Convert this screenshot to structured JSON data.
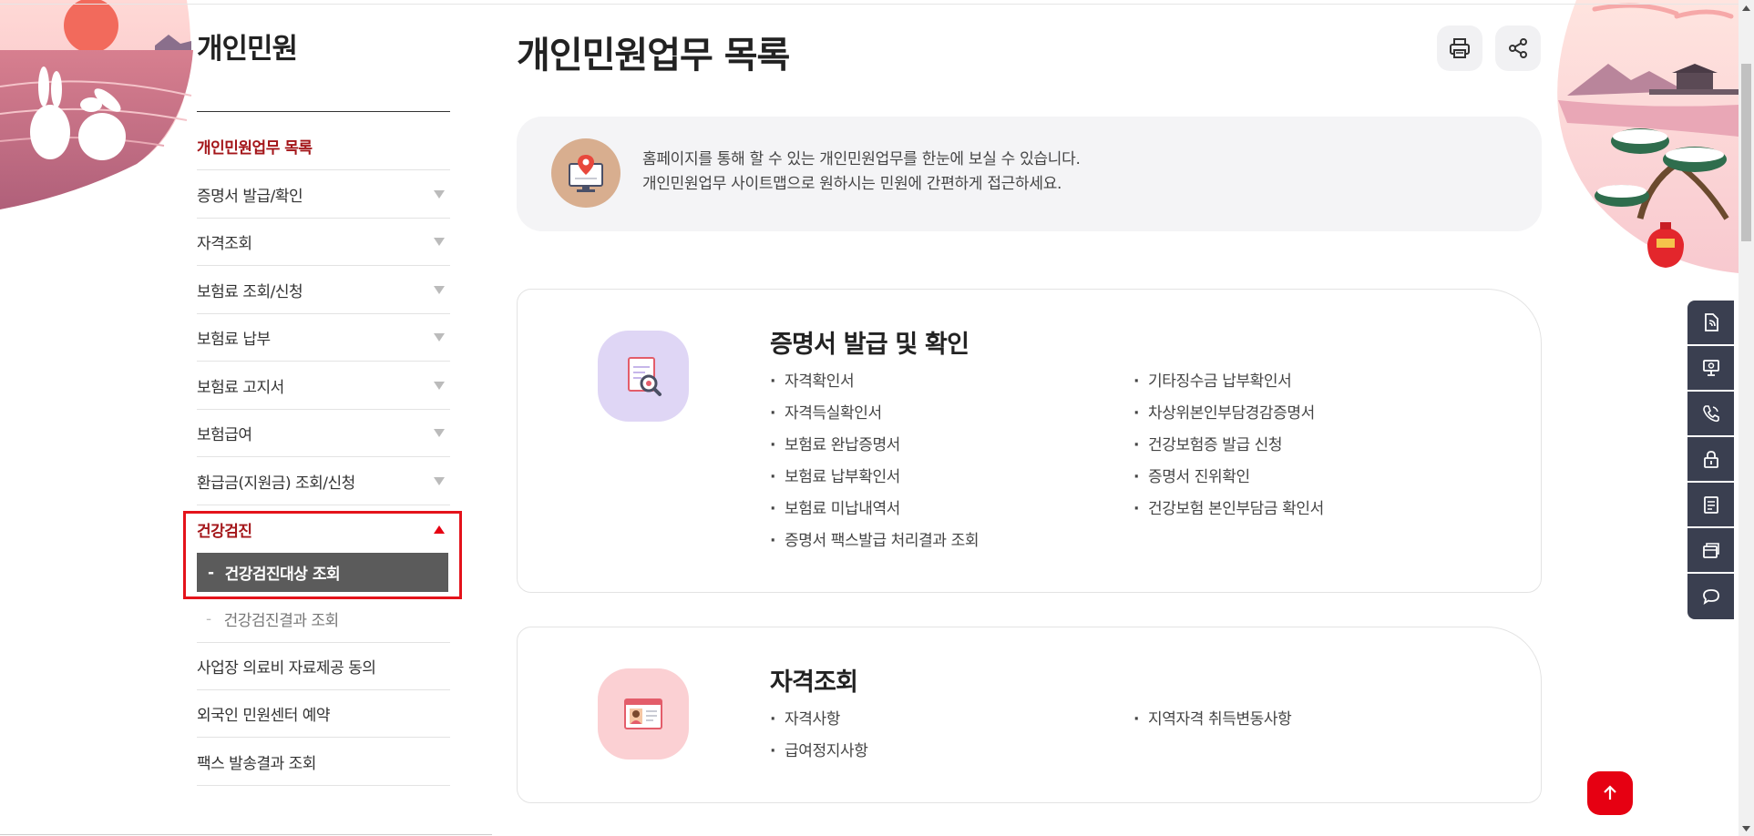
{
  "sidebar": {
    "title": "개인민원",
    "items": [
      {
        "label": "개인민원업무 목록"
      },
      {
        "label": "증명서 발급/확인"
      },
      {
        "label": "자격조회"
      },
      {
        "label": "보험료 조회/신청"
      },
      {
        "label": "보험료 납부"
      },
      {
        "label": "보험료 고지서"
      },
      {
        "label": "보험급여"
      },
      {
        "label": "환급금(지원금) 조회/신청"
      },
      {
        "label": "건강검진"
      },
      {
        "label": "사업장 의료비 자료제공 동의"
      },
      {
        "label": "외국인 민원센터 예약"
      },
      {
        "label": "팩스 발송결과 조회"
      }
    ],
    "sub_items": [
      {
        "label": "건강검진대상 조회"
      },
      {
        "label": "건강검진결과 조회"
      }
    ],
    "sub_dash": "-"
  },
  "main": {
    "title": "개인민원업무 목록",
    "intro_line1": "홈페이지를 통해 할 수 있는 개인민원업무를 한눈에 보실 수 있습니다.",
    "intro_line2": "개인민원업무 사이트맵으로 원하시는 민원에 간편하게 접근하세요.",
    "cards": [
      {
        "title": "증명서 발급 및 확인",
        "col1": [
          "자격확인서",
          "자격득실확인서",
          "보험료 완납증명서",
          "보험료 납부확인서",
          "보험료 미납내역서",
          "증명서 팩스발급 처리결과 조회"
        ],
        "col2": [
          "기타징수금 납부확인서",
          "차상위본인부담경감증명서",
          "건강보험증 발급 신청",
          "증명서 진위확인",
          "건강보험 본인부담금 확인서"
        ]
      },
      {
        "title": "자격조회",
        "col1": [
          "자격사항",
          "급여정지사항"
        ],
        "col2": [
          "지역자격 취득변동사항"
        ]
      }
    ]
  },
  "icons": {
    "print": "printer-icon",
    "share": "share-icon",
    "quick_menu": [
      "document-icon",
      "monitor-icon",
      "phone-icon",
      "lock-icon",
      "note-icon",
      "cards-icon",
      "chat-icon"
    ],
    "top": "arrow-up-icon"
  },
  "colors": {
    "accent_red": "#e60012",
    "active_text": "#a4161a",
    "quick_bg": "#3a3f50",
    "active_sub_bg": "#5b5b5b"
  }
}
